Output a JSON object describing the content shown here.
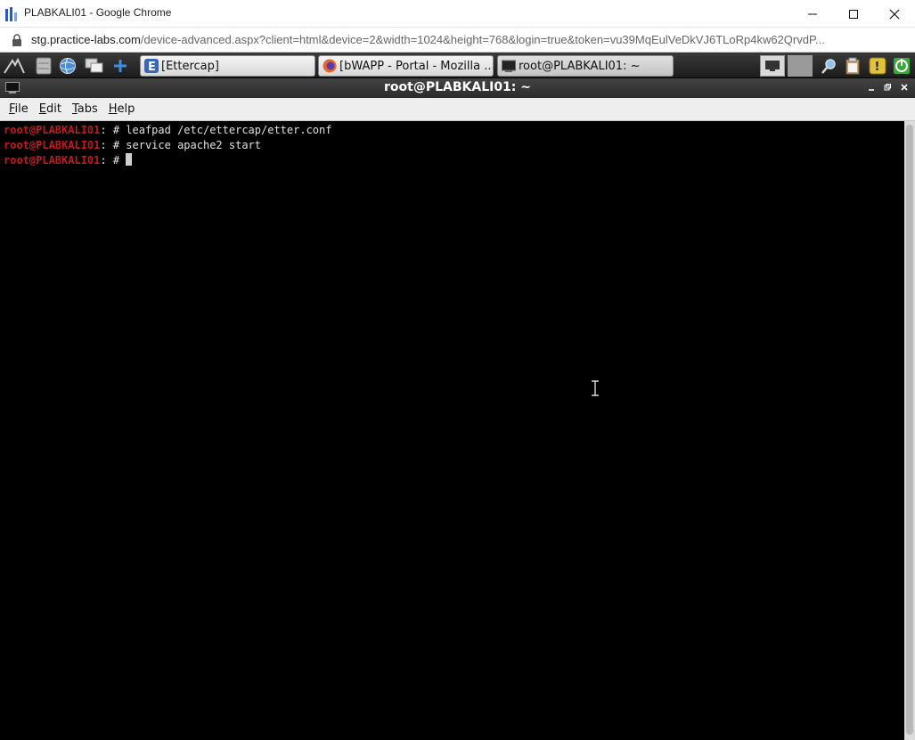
{
  "browser": {
    "window_title": "PLABKALI01 - Google Chrome",
    "url_host": "stg.practice-labs.com",
    "url_rest": "/device-advanced.aspx?client=html&device=2&width=1024&height=768&login=true&token=vu39MqEulVeDkVJ6TLoRp4kw62QrvdP..."
  },
  "taskbar": {
    "tasks": [
      {
        "label": "[Ettercap]"
      },
      {
        "label": "[bWAPP - Portal - Mozilla ..."
      },
      {
        "label": "root@PLABKALI01: ~"
      }
    ]
  },
  "terminal_window": {
    "title": "root@PLABKALI01: ~",
    "menu": [
      {
        "label": "File",
        "accel": "F",
        "rest": "ile"
      },
      {
        "label": "Edit",
        "accel": "E",
        "rest": "dit"
      },
      {
        "label": "Tabs",
        "accel": "T",
        "rest": "abs"
      },
      {
        "label": "Help",
        "accel": "H",
        "rest": "elp"
      }
    ]
  },
  "terminal": {
    "prompt": "root@PLABKALI01",
    "lines": [
      {
        "suffix": ": # ",
        "command": "leafpad /etc/ettercap/etter.conf"
      },
      {
        "suffix": ": # ",
        "command": "service apache2 start"
      },
      {
        "suffix": ": # ",
        "command": ""
      }
    ]
  },
  "colors": {
    "prompt": "#c41a1a",
    "terminal_bg": "#000000",
    "terminal_fg": "#e0e0e0"
  }
}
